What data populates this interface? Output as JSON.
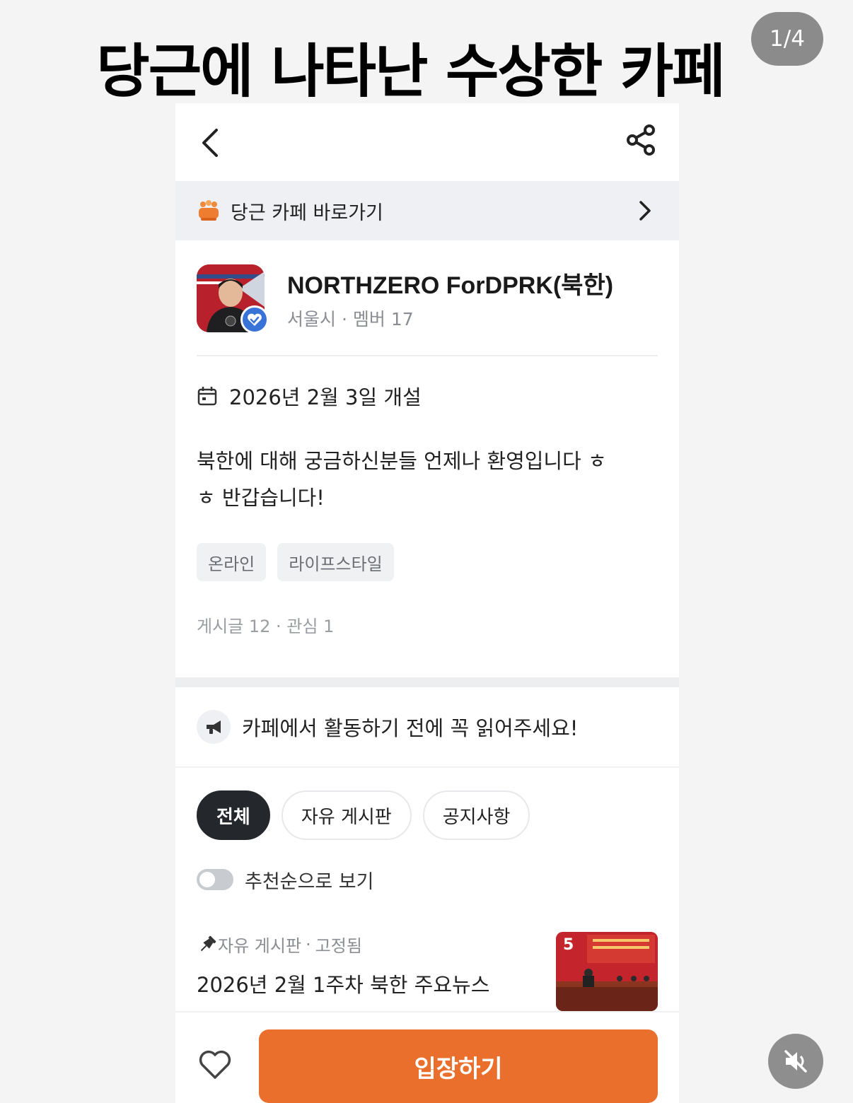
{
  "headline": "당근에 나타난 수상한 카페",
  "page_counter": "1/4",
  "cafe_link": {
    "label": "당근 카페 바로가기"
  },
  "profile": {
    "name": "NORTHZERO ForDPRK(북한)",
    "location": "서울시",
    "members": "멤버 17"
  },
  "opened": "2026년 2월 3일 개설",
  "intro_line1": "북한에 대해 궁금하신분들 언제나 환영입니다 ㅎ",
  "intro_line2": "ㅎ 반갑습니다!",
  "tags": [
    "온라인",
    "라이프스타일"
  ],
  "stats": "게시글 12 · 관심 1",
  "notice": "카페에서 활동하기 전에 꼭 읽어주세요!",
  "tabs": [
    "전체",
    "자유 게시판",
    "공지사항"
  ],
  "sort_toggle": {
    "label": "추천순으로 보기",
    "on": false
  },
  "post": {
    "board": "자유 게시판",
    "status": "고정됨",
    "title": "2026년 2월 1주차 북한 주요뉴스",
    "image_count": "5"
  },
  "enter_button": "입장하기",
  "colors": {
    "accent": "#ea6f2c",
    "chip_active": "#24272c",
    "badge": "#3a73d8"
  }
}
